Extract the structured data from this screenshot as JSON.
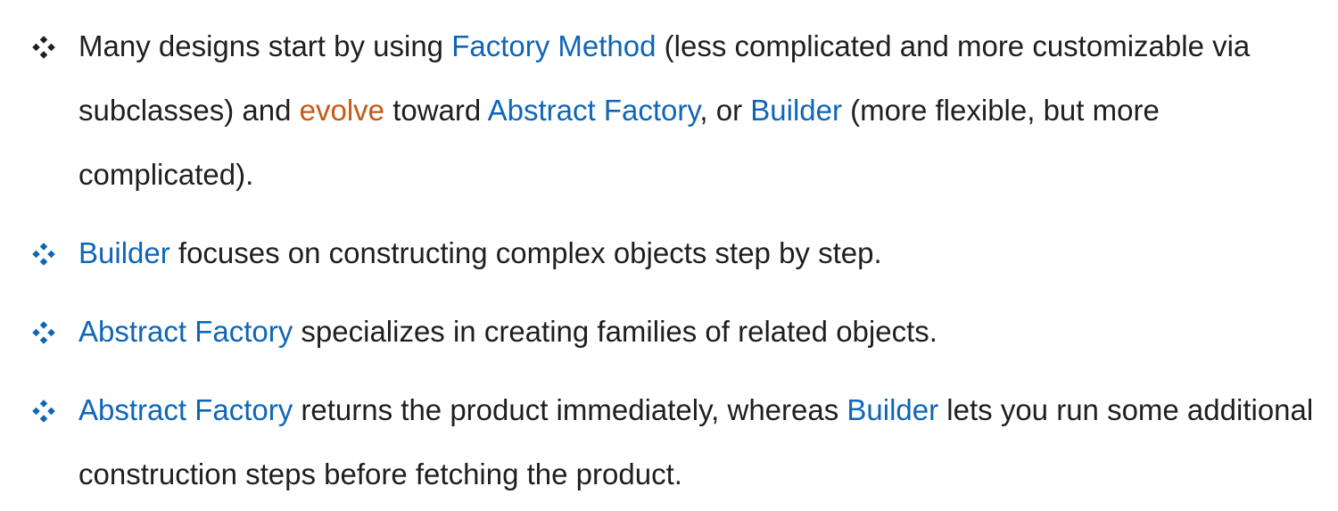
{
  "colors": {
    "text": "#1f1f1f",
    "link": "#0f66b8",
    "accent": "#c55a11"
  },
  "bullets": [
    {
      "marker_color": "#1f1f1f",
      "marker_icon": "four-diamond-icon",
      "segments": [
        {
          "text": "Many designs start by using ",
          "style": "plain"
        },
        {
          "text": "Factory Method",
          "style": "link"
        },
        {
          "text": " (less complicated and more customizable via subclasses) and ",
          "style": "plain"
        },
        {
          "text": "evolve",
          "style": "accent"
        },
        {
          "text": " toward ",
          "style": "plain"
        },
        {
          "text": "Abstract Factory",
          "style": "link"
        },
        {
          "text": ", or ",
          "style": "plain"
        },
        {
          "text": "Builder",
          "style": "link"
        },
        {
          "text": " (more flexible, but more complicated).",
          "style": "plain"
        }
      ]
    },
    {
      "marker_color": "#0f66b8",
      "marker_icon": "four-diamond-icon",
      "segments": [
        {
          "text": "Builder",
          "style": "link"
        },
        {
          "text": " focuses on constructing complex objects step by step.",
          "style": "plain"
        }
      ]
    },
    {
      "marker_color": "#0f66b8",
      "marker_icon": "four-diamond-icon",
      "segments": [
        {
          "text": "Abstract Factory",
          "style": "link"
        },
        {
          "text": " specializes in creating families of related objects.",
          "style": "plain"
        }
      ]
    },
    {
      "marker_color": "#0f66b8",
      "marker_icon": "four-diamond-icon",
      "segments": [
        {
          "text": "Abstract Factory",
          "style": "link"
        },
        {
          "text": " returns the product immediately, whereas ",
          "style": "plain"
        },
        {
          "text": "Builder",
          "style": "link"
        },
        {
          "text": " lets you run some additional construction steps before fetching the product.",
          "style": "plain"
        }
      ]
    }
  ]
}
